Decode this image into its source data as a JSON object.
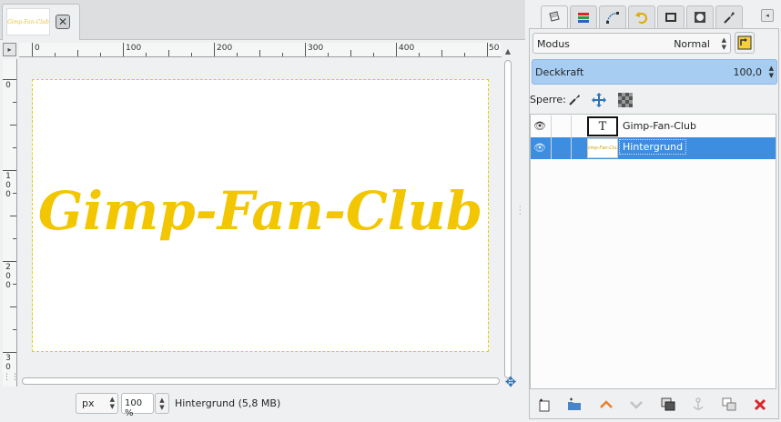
{
  "image_tab": {
    "thumbnail_text": "Gimp-Fan-Club",
    "close_symbol": "✕"
  },
  "rulers": {
    "horizontal_labels": [
      "0",
      "100",
      "200",
      "300",
      "400",
      "50"
    ],
    "vertical_labels": [
      "0",
      "100",
      "200",
      "30"
    ]
  },
  "canvas": {
    "artwork_text": "Gimp-Fan-Club",
    "text_color": "#f2c600"
  },
  "statusbar": {
    "unit": "px",
    "zoom": "100 %",
    "info": "Hintergrund (5,8 MB)"
  },
  "dock": {
    "tabs": [
      {
        "icon": "layers-icon",
        "active": true
      },
      {
        "icon": "channels-icon",
        "active": false
      },
      {
        "icon": "paths-icon",
        "active": false
      },
      {
        "icon": "undo-history-icon",
        "active": false
      },
      {
        "icon": "image-icon",
        "active": false
      },
      {
        "icon": "brushes-icon",
        "active": false
      },
      {
        "icon": "tool-options-icon",
        "active": false
      }
    ],
    "mode_label": "Modus",
    "mode_value": "Normal",
    "opacity_label": "Deckkraft",
    "opacity_value": "100,0",
    "lock_label": "Sperre:",
    "layers": [
      {
        "name": "Gimp-Fan-Club",
        "type": "text",
        "thumb_text": "T",
        "selected": false
      },
      {
        "name": "Hintergrund",
        "type": "image",
        "thumb_text": "Gimp-Fan-Club",
        "selected": true
      }
    ]
  },
  "colors": {
    "accent": "#3d8ee0",
    "opacity_bar": "#a8cdf2",
    "delete_red": "#d9262b",
    "raise_orange": "#e8802c"
  }
}
